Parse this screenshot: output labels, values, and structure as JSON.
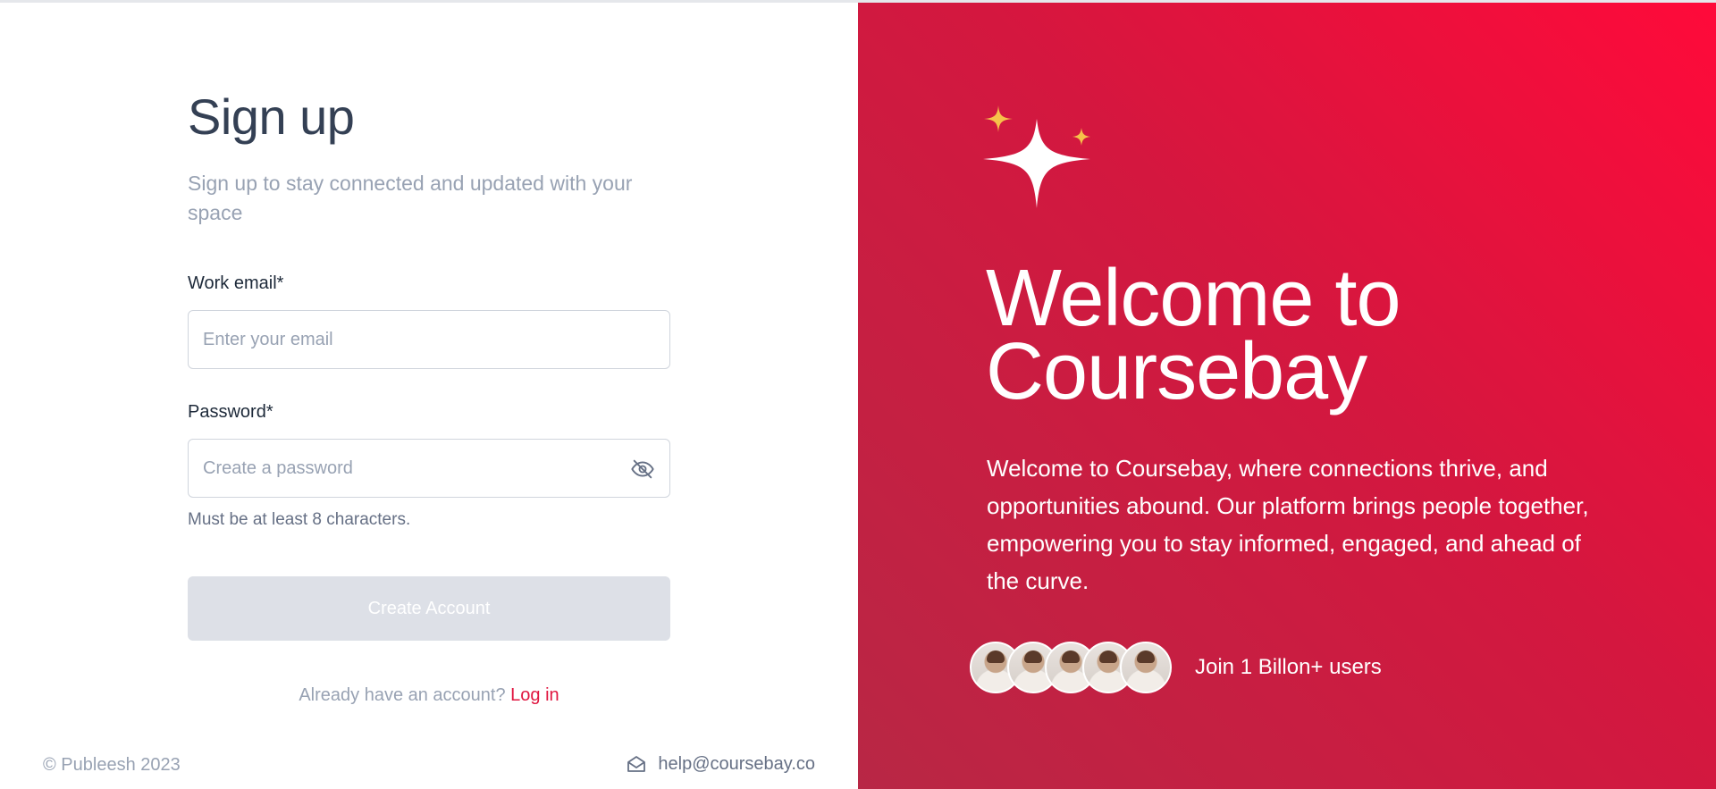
{
  "signup": {
    "title": "Sign up",
    "subtitle": "Sign up to stay connected and updated with your space",
    "email_label": "Work email*",
    "email_placeholder": "Enter your email",
    "email_value": "",
    "password_label": "Password*",
    "password_placeholder": "Create a password",
    "password_value": "",
    "password_hint": "Must be at least 8 characters.",
    "create_button": "Create Account",
    "already_text": "Already have an account?",
    "login_link": "Log in"
  },
  "footer": {
    "copyright": "© Publeesh 2023",
    "email": "help@coursebay.co"
  },
  "hero": {
    "heading": "Welcome to Coursebay",
    "description": "Welcome to Coursebay, where connections thrive, and opportunities abound. Our platform brings people together, empowering you to stay informed, engaged, and ahead of the curve.",
    "users_text": "Join 1 Billon+ users",
    "avatar_count": 5
  },
  "colors": {
    "accent": "#e0153f",
    "hero_gradient_start": "#ff0a3a",
    "hero_gradient_end": "#b82745",
    "sparkle_small": "#f6c14a",
    "button_disabled": "#dde0e7"
  },
  "icons": [
    "eye-off-icon",
    "mail-icon",
    "sparkle-icon"
  ]
}
